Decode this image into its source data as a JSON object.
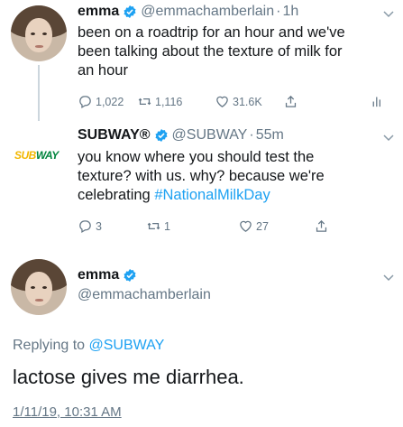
{
  "tweet1": {
    "display_name": "emma",
    "handle": "@emmachamberlain",
    "time": "1h",
    "text_lines": [
      "been on a roadtrip for an hour and we've",
      "been talking about the texture of milk for",
      "an hour"
    ],
    "replies": "1,022",
    "retweets": "1,116",
    "likes": "31.6K"
  },
  "tweet2": {
    "display_name": "SUBWAY®",
    "handle": "@SUBWAY",
    "time": "55m",
    "logo_sub": "SUB",
    "logo_way": "WAY",
    "text_lines": [
      "you know where you should test the",
      "texture? with us. why? because we're",
      "celebrating "
    ],
    "hashtag": "#NationalMilkDay",
    "replies": "3",
    "retweets": "1",
    "likes": "27"
  },
  "tweet3": {
    "display_name": "emma",
    "handle": "@emmachamberlain",
    "replying_label": "Replying to ",
    "replying_mention": "@SUBWAY",
    "text": "lactose gives me diarrhea.",
    "timestamp": "1/11/19, 10:31 AM"
  },
  "icons": {
    "reply": "reply-icon",
    "retweet": "retweet-icon",
    "like": "heart-icon",
    "share": "share-icon",
    "analytics": "analytics-icon",
    "verified": "verified-badge-icon",
    "caret": "chevron-down-icon"
  },
  "colors": {
    "verified": "#1da1f2",
    "link": "#1da1f2",
    "muted": "#657786",
    "subway_yellow": "#f2b700",
    "subway_green": "#00843d"
  }
}
